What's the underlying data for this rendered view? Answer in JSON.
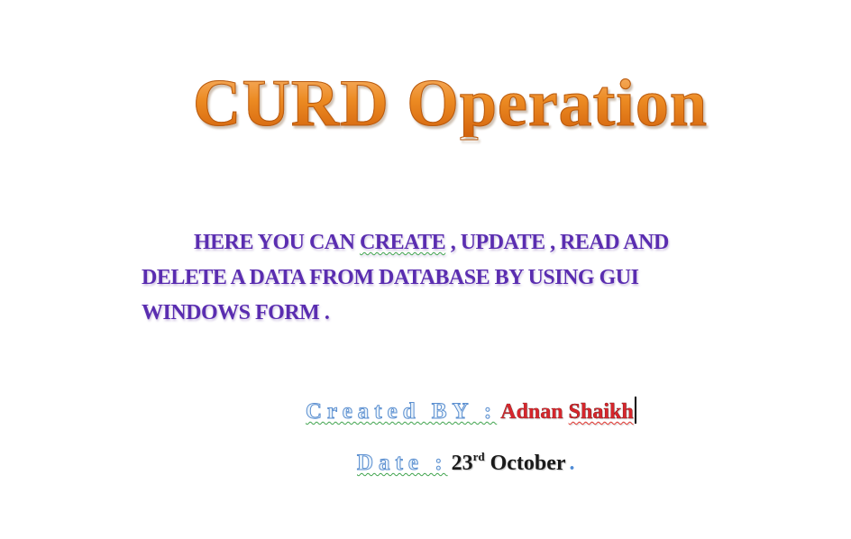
{
  "title": "CURD Operation",
  "description": {
    "line1_pre": "HERE YOU CAN ",
    "create_word": "CREATE",
    "line1_post": " , UPDATE , READ AND DELETE A DATA FROM DATABASE BY USING GUI WINDOWS FORM ."
  },
  "credits": {
    "created_label": "Created BY :",
    "author_first": "Adnan",
    "author_last": "Shaikh"
  },
  "date": {
    "label": "Date :",
    "day": "23",
    "suffix": "rd",
    "month": "October",
    "end_dot": "."
  },
  "colors": {
    "title_orange": "#ec8a22",
    "body_purple": "#5a2db0",
    "label_blue": "#5b8fd0",
    "author_red": "#d8262c"
  }
}
